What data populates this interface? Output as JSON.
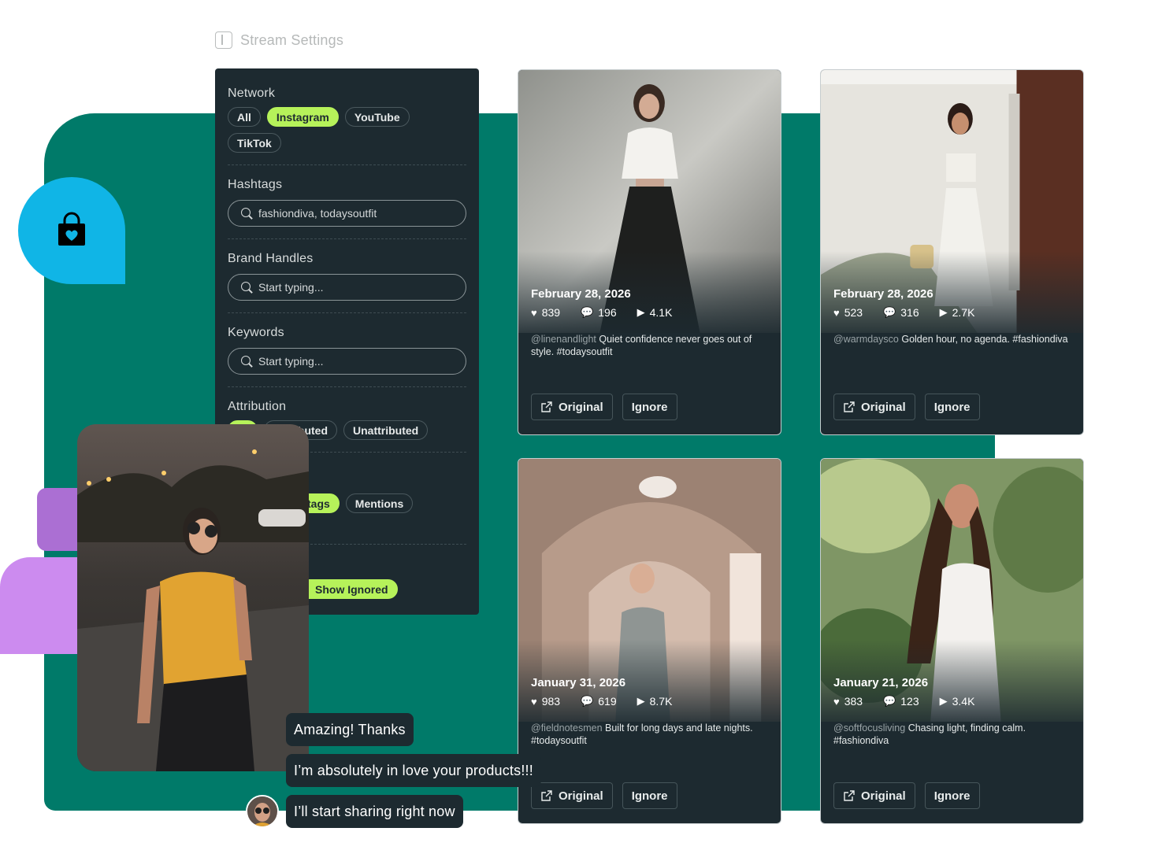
{
  "header": {
    "title": "Stream Settings"
  },
  "filters": {
    "network": {
      "label": "Network",
      "options": [
        "All",
        "Instagram",
        "YouTube",
        "TikTok"
      ],
      "selected": "Instagram"
    },
    "hashtags": {
      "label": "Hashtags",
      "value": "fashiondiva, todaysoutfit"
    },
    "brand_handles": {
      "label": "Brand Handles",
      "placeholder": "Start typing..."
    },
    "keywords": {
      "label": "Keywords",
      "placeholder": "Start typing..."
    },
    "attribution": {
      "label": "Attribution",
      "visible_options": [
        "ibuted",
        "Unattributed"
      ]
    },
    "source": {
      "visible_options": [
        "tags",
        "Mentions"
      ]
    },
    "ignored": {
      "label": "Show Ignored"
    }
  },
  "posts": [
    {
      "date": "February 28, 2026",
      "likes": "839",
      "comments": "196",
      "views": "4.1K",
      "handle": "@linenandlight",
      "text": "Quiet confidence never goes out of style. #todaysoutfit"
    },
    {
      "date": "February 28, 2026",
      "likes": "523",
      "comments": "316",
      "views": "2.7K",
      "handle": "@warmdaysco",
      "text": "Golden hour, no agenda. #fashiondiva"
    },
    {
      "date": "January 31, 2026",
      "likes": "983",
      "comments": "619",
      "views": "8.7K",
      "handle": "@fieldnotesmen",
      "text": "Built for long days and late nights. #todaysoutfit"
    },
    {
      "date": "January 21, 2026",
      "likes": "383",
      "comments": "123",
      "views": "3.4K",
      "handle": "@softfocusliving",
      "text": "Chasing light, finding calm. #fashiondiva"
    }
  ],
  "actions": {
    "original": "Original",
    "ignore": "Ignore"
  },
  "chat": [
    "Amazing! Thanks",
    "I’m absolutely in love your products!!!",
    "I’ll start sharing right now"
  ],
  "icons": {
    "heart": "♥",
    "comment": "💬",
    "play": "▶"
  },
  "colors": {
    "accent": "#b6f25a",
    "panel": "#1d2a30",
    "teal": "#007a69",
    "badge": "#10b5e6"
  }
}
